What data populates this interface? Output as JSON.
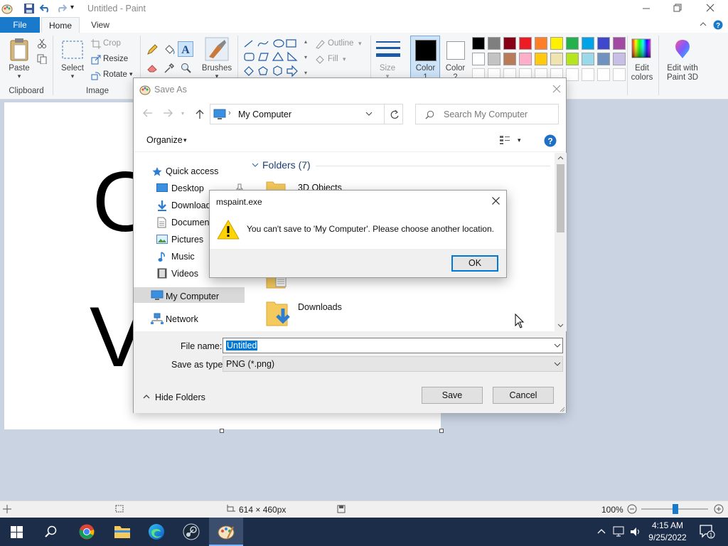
{
  "app": {
    "title": "Untitled - Paint"
  },
  "menu": {
    "file": "File",
    "home": "Home",
    "view": "View"
  },
  "ribbon": {
    "paste": "Paste",
    "clipboard": "Clipboard",
    "select": "Select",
    "crop": "Crop",
    "resize": "Resize",
    "rotate": "Rotate",
    "image": "Image",
    "brushes": "Brushes",
    "outline": "Outline",
    "fill": "Fill",
    "size": "Size",
    "color1": "Color 1",
    "color2": "Color 2",
    "edit_colors": "Edit colors",
    "edit_paint3d": "Edit with Paint 3D",
    "palette_row1": [
      "#000000",
      "#7f7f7f",
      "#880015",
      "#ed1c24",
      "#ff7f27",
      "#fff200",
      "#22b14c",
      "#00a2e8",
      "#3f48cc",
      "#a349a4"
    ],
    "palette_row2": [
      "#ffffff",
      "#c3c3c3",
      "#b97a57",
      "#ffaec9",
      "#ffc90e",
      "#efe4b0",
      "#b5e61d",
      "#99d9ea",
      "#7092be",
      "#c8bfe7"
    ]
  },
  "canvas_text": {
    "top": "O",
    "bottom": "V"
  },
  "save_dialog": {
    "title": "Save As",
    "address": "My Computer",
    "search_placeholder": "Search My Computer",
    "organize": "Organize",
    "nav": {
      "quick_access": "Quick access",
      "desktop": "Desktop",
      "downloads": "Downloads",
      "documents": "Documents",
      "pictures": "Pictures",
      "music": "Music",
      "videos": "Videos",
      "my_computer": "My Computer",
      "network": "Network"
    },
    "folders_header": "Folders (7)",
    "folder_items": [
      "3D Objects",
      "Downloads"
    ],
    "file_name_label": "File name:",
    "file_name_value": "Untitled",
    "save_type_label": "Save as type:",
    "save_type_value": "PNG (*.png)",
    "hide_folders": "Hide Folders",
    "save_btn": "Save",
    "cancel_btn": "Cancel"
  },
  "message_box": {
    "title": "mspaint.exe",
    "text": "You can't save to 'My Computer'. Please choose another location.",
    "ok": "OK"
  },
  "status": {
    "dimensions": "614 × 460px",
    "zoom": "100%"
  },
  "taskbar": {
    "time": "4:15 AM",
    "date": "9/25/2022"
  }
}
